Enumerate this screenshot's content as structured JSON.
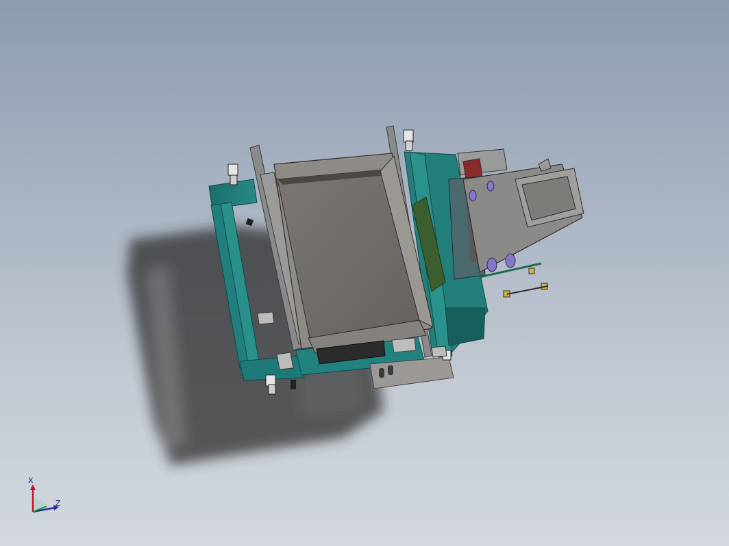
{
  "triad": {
    "x_label": "X",
    "z_label": "Z",
    "colors": {
      "x": "#c8102e",
      "y": "#1a9a2a",
      "z": "#1c2ea0"
    }
  },
  "scene": {
    "background_top": "#8d9cb0",
    "background_bottom": "#d3d8de",
    "frame_color": "#1e7a78",
    "sheet_color": "#7a7672",
    "bin_interior_color": "#6c6864",
    "profile_color": "#8a8886",
    "shadow_color": "#2c2c2c"
  }
}
